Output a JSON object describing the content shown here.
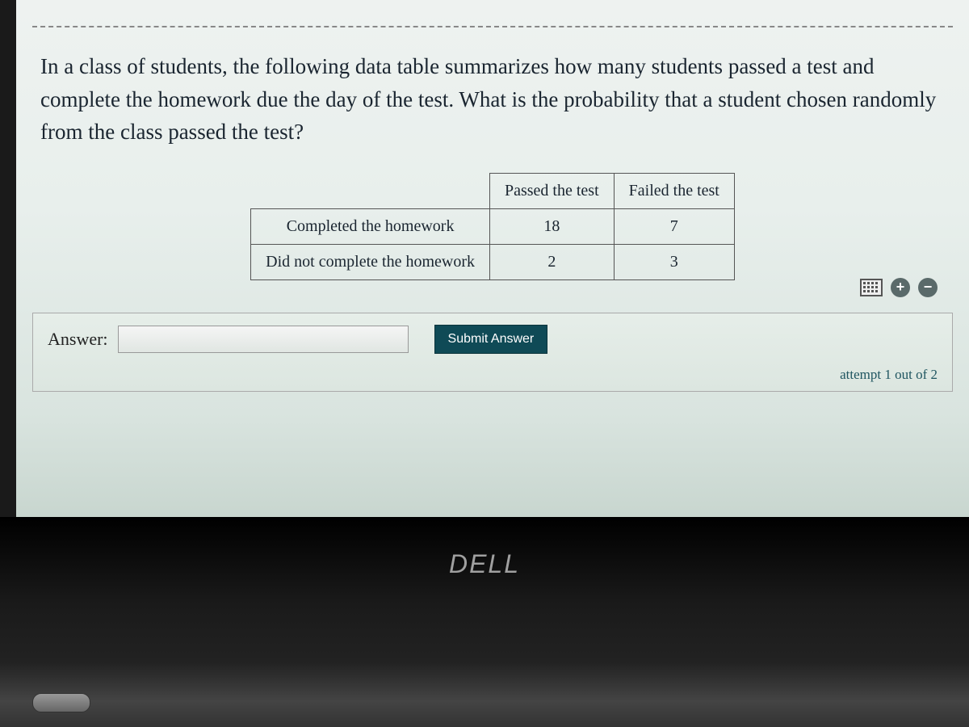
{
  "question": {
    "prompt": "In a class of students, the following data table summarizes how many students passed a test and complete the homework due the day of the test. What is the probability that a student chosen randomly from the class passed the test?"
  },
  "table": {
    "col_headers": [
      "Passed the test",
      "Failed the test"
    ],
    "rows": [
      {
        "label": "Completed the homework",
        "cells": [
          "18",
          "7"
        ]
      },
      {
        "label": "Did not complete the homework",
        "cells": [
          "2",
          "3"
        ]
      }
    ]
  },
  "answer_area": {
    "label": "Answer:",
    "input_value": "",
    "submit_label": "Submit Answer",
    "attempt_text": "attempt 1 out of 2"
  },
  "icons": {
    "keyboard": "keyboard-icon",
    "plus": "+",
    "minus": "−"
  },
  "device": {
    "brand": "DELL"
  },
  "chart_data": {
    "type": "table",
    "title": "Students passed/failed vs homework completion",
    "col_headers": [
      "Passed the test",
      "Failed the test"
    ],
    "row_headers": [
      "Completed the homework",
      "Did not complete the homework"
    ],
    "values": [
      [
        18,
        7
      ],
      [
        2,
        3
      ]
    ]
  }
}
